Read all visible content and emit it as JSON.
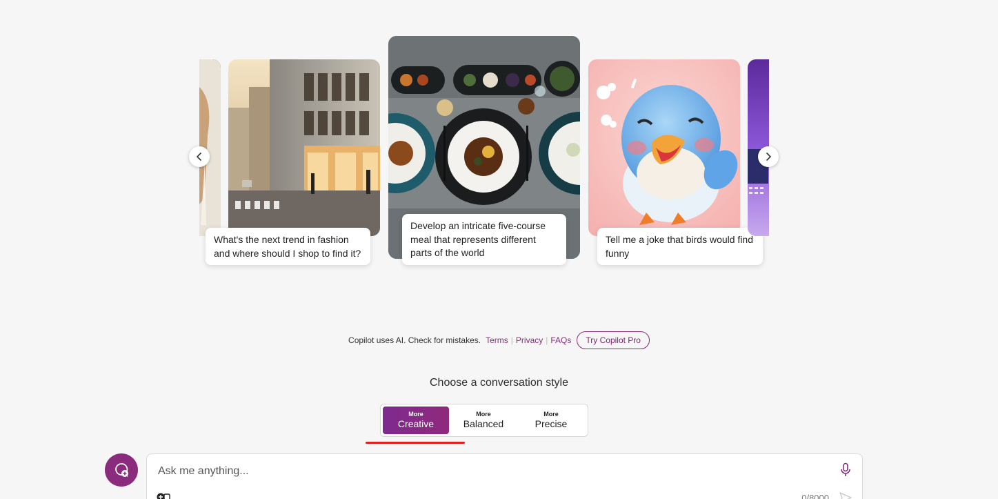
{
  "carousel": {
    "cards": [
      {
        "caption": "What's the next trend in fashion and where should I shop to find it?"
      },
      {
        "caption": "Develop an intricate five-course meal that represents different parts of the world"
      },
      {
        "caption": "Tell me a joke that birds would find funny"
      }
    ]
  },
  "disclaimer": {
    "text": "Copilot uses AI. Check for mistakes.",
    "terms": "Terms",
    "privacy": "Privacy",
    "faqs": "FAQs",
    "pro_button": "Try Copilot Pro"
  },
  "conversation_style": {
    "title": "Choose a conversation style",
    "options": [
      {
        "small": "More",
        "label": "Creative",
        "active": true
      },
      {
        "small": "More",
        "label": "Balanced",
        "active": false
      },
      {
        "small": "More",
        "label": "Precise",
        "active": false
      }
    ]
  },
  "input": {
    "placeholder": "Ask me anything...",
    "counter": "0/8000"
  },
  "colors": {
    "accent": "#8a2b7e",
    "underline": "#e0201e"
  }
}
